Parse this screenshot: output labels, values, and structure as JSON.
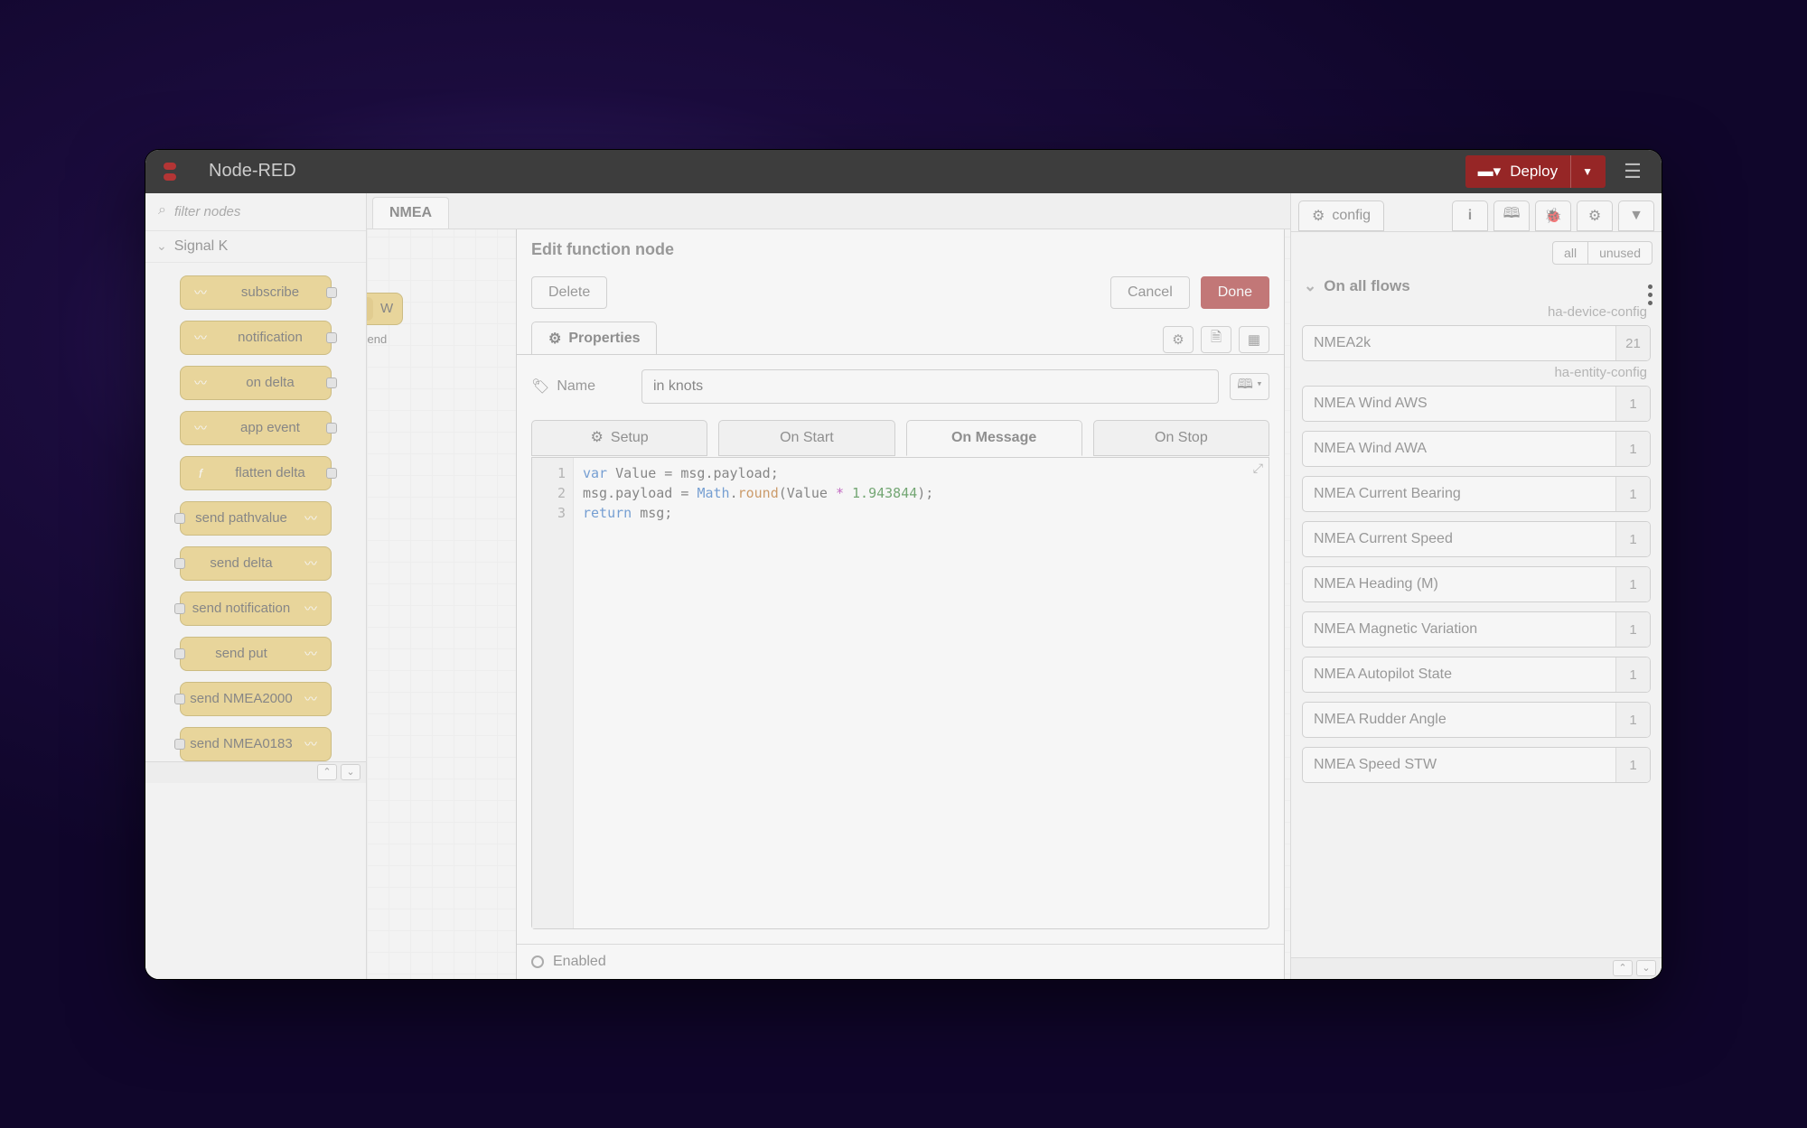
{
  "header": {
    "title": "Node-RED",
    "deploy_label": "Deploy"
  },
  "palette": {
    "filter_placeholder": "filter nodes",
    "category": "Signal K",
    "nodes": [
      {
        "label": "subscribe",
        "dir": "in"
      },
      {
        "label": "notification",
        "dir": "in"
      },
      {
        "label": "on delta",
        "dir": "in"
      },
      {
        "label": "app event",
        "dir": "in"
      },
      {
        "label": "flatten delta",
        "dir": "fn"
      },
      {
        "label": "send pathvalue",
        "dir": "out"
      },
      {
        "label": "send delta",
        "dir": "out"
      },
      {
        "label": "send notification",
        "dir": "out"
      },
      {
        "label": "send put",
        "dir": "out"
      },
      {
        "label": "send NMEA2000",
        "dir": "out"
      },
      {
        "label": "send NMEA0183",
        "dir": "out"
      }
    ]
  },
  "workspace": {
    "tab": "NMEA",
    "canvas_node": "W",
    "canvas_status": "send"
  },
  "dialog": {
    "title": "Edit function node",
    "delete": "Delete",
    "cancel": "Cancel",
    "done": "Done",
    "properties_tab": "Properties",
    "name_label": "Name",
    "name_value": "in knots",
    "subtabs": {
      "setup": "Setup",
      "onstart": "On Start",
      "onmessage": "On Message",
      "onstop": "On Stop"
    },
    "code": {
      "l1_kw": "var",
      "l1_rest": " Value = msg.payload;",
      "l2a": "msg.payload = ",
      "l2_obj": "Math",
      "l2_dot": ".",
      "l2_fn": "round",
      "l2b": "(Value ",
      "l2_op": "*",
      "l2_sp": " ",
      "l2_num": "1.943844",
      "l2c": ");",
      "l3_kw": "return",
      "l3_rest": " msg;"
    },
    "enabled": "Enabled"
  },
  "sidebar": {
    "config_tab": "config",
    "filters": {
      "all": "all",
      "unused": "unused"
    },
    "section": "On all flows",
    "group1_label": "ha-device-config",
    "group1": [
      {
        "name": "NMEA2k",
        "count": "21"
      }
    ],
    "group2_label": "ha-entity-config",
    "group2": [
      {
        "name": "NMEA Wind AWS",
        "count": "1"
      },
      {
        "name": "NMEA Wind AWA",
        "count": "1"
      },
      {
        "name": "NMEA Current Bearing",
        "count": "1"
      },
      {
        "name": "NMEA Current Speed",
        "count": "1"
      },
      {
        "name": "NMEA Heading (M)",
        "count": "1"
      },
      {
        "name": "NMEA Magnetic Variation",
        "count": "1"
      },
      {
        "name": "NMEA Autopilot State",
        "count": "1"
      },
      {
        "name": "NMEA Rudder Angle",
        "count": "1"
      },
      {
        "name": "NMEA Speed STW",
        "count": "1"
      }
    ]
  }
}
